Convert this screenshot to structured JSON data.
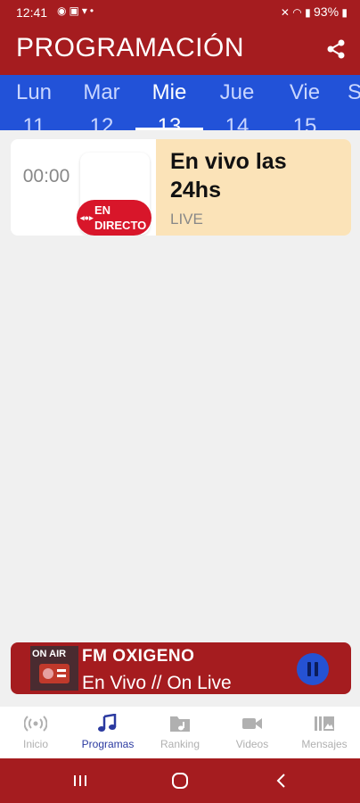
{
  "status_bar": {
    "time": "12:41",
    "left_icons": [
      "whatsapp-icon",
      "gallery-icon",
      "cast-icon",
      "dot-icon"
    ],
    "right_icons": [
      "mute-icon",
      "wifi-icon",
      "signal-icon"
    ],
    "battery": "93%"
  },
  "app_bar": {
    "title": "PROGRAMACIÓN",
    "share_icon": "share-icon"
  },
  "days": [
    {
      "name": "Lun",
      "num": "11"
    },
    {
      "name": "Mar",
      "num": "12"
    },
    {
      "name": "Mie",
      "num": "13",
      "active": true
    },
    {
      "name": "Jue",
      "num": "14"
    },
    {
      "name": "Vie",
      "num": "15"
    },
    {
      "name": "S",
      "num": ""
    }
  ],
  "program": {
    "time": "00:00",
    "badge": "EN DIRECTO",
    "title": "En vivo las 24hs",
    "tag": "LIVE"
  },
  "player": {
    "art_label": "ON AIR",
    "station": "FM OXIGENO",
    "subtitle": "En Vivo // On Live",
    "state_icon": "pause-icon"
  },
  "bottom_nav": [
    {
      "label": "Inicio",
      "icon": "radio-icon"
    },
    {
      "label": "Programas",
      "icon": "music-note-icon",
      "active": true
    },
    {
      "label": "Ranking",
      "icon": "music-folder-icon"
    },
    {
      "label": "Videos",
      "icon": "video-camera-icon"
    },
    {
      "label": "Mensajes",
      "icon": "gallery-icon"
    }
  ],
  "colors": {
    "primary_red": "#a51c1f",
    "day_bar_blue": "#2252d8",
    "card_info_bg": "#fbe3b8",
    "badge_red": "#d8162a",
    "nav_active": "#2b3aa0"
  }
}
